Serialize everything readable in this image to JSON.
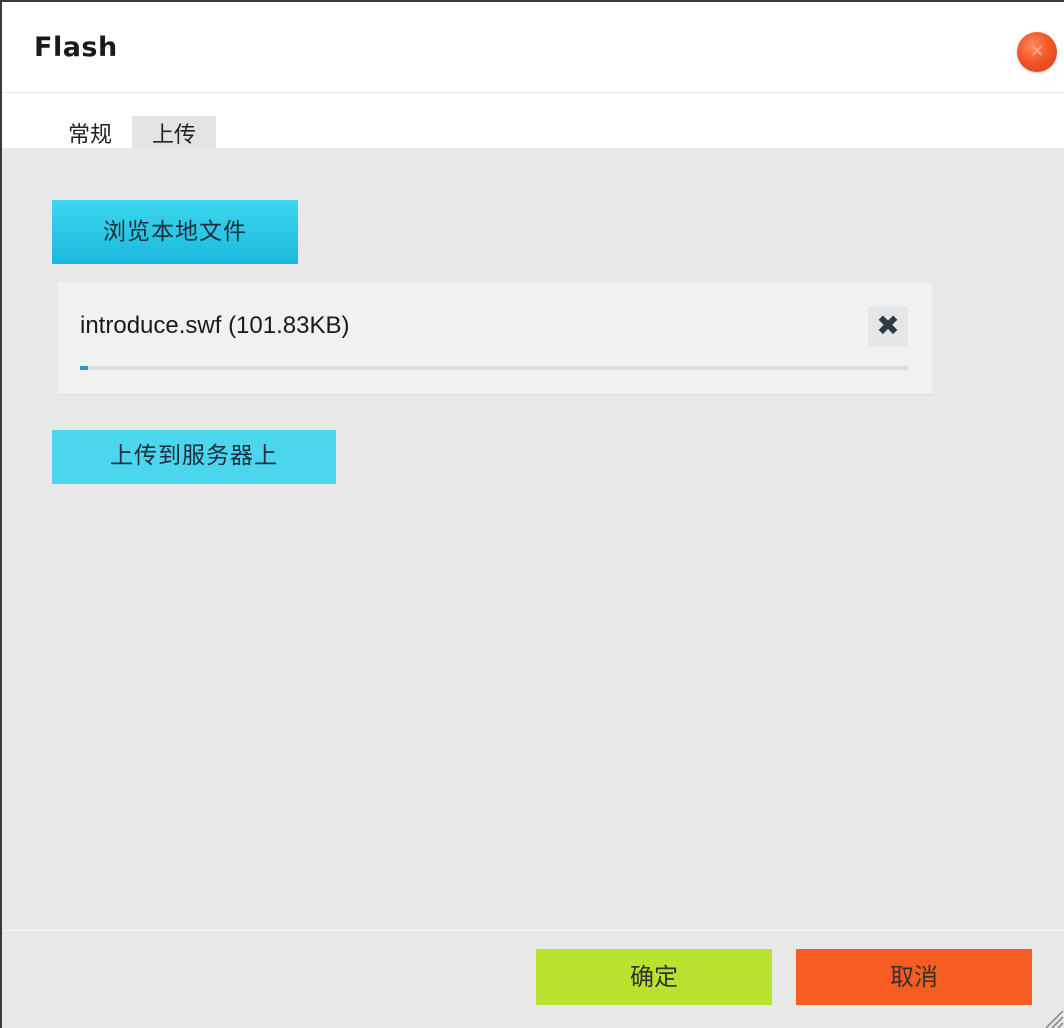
{
  "dialog": {
    "title": "Flash",
    "close_icon": "×"
  },
  "tabs": [
    {
      "label": "常规",
      "active": false
    },
    {
      "label": "上传",
      "active": true
    }
  ],
  "upload": {
    "browse_label": "浏览本地文件",
    "file": {
      "name": "introduce.swf (101.83KB)",
      "remove_icon": "✖",
      "progress": 0.01
    },
    "upload_label": "上传到服务器上"
  },
  "footer": {
    "ok_label": "确定",
    "cancel_label": "取消"
  },
  "colors": {
    "accent": "#1ab8dc",
    "ok": "#b9e22e",
    "cancel": "#f75d22",
    "close": "#f2562a"
  }
}
